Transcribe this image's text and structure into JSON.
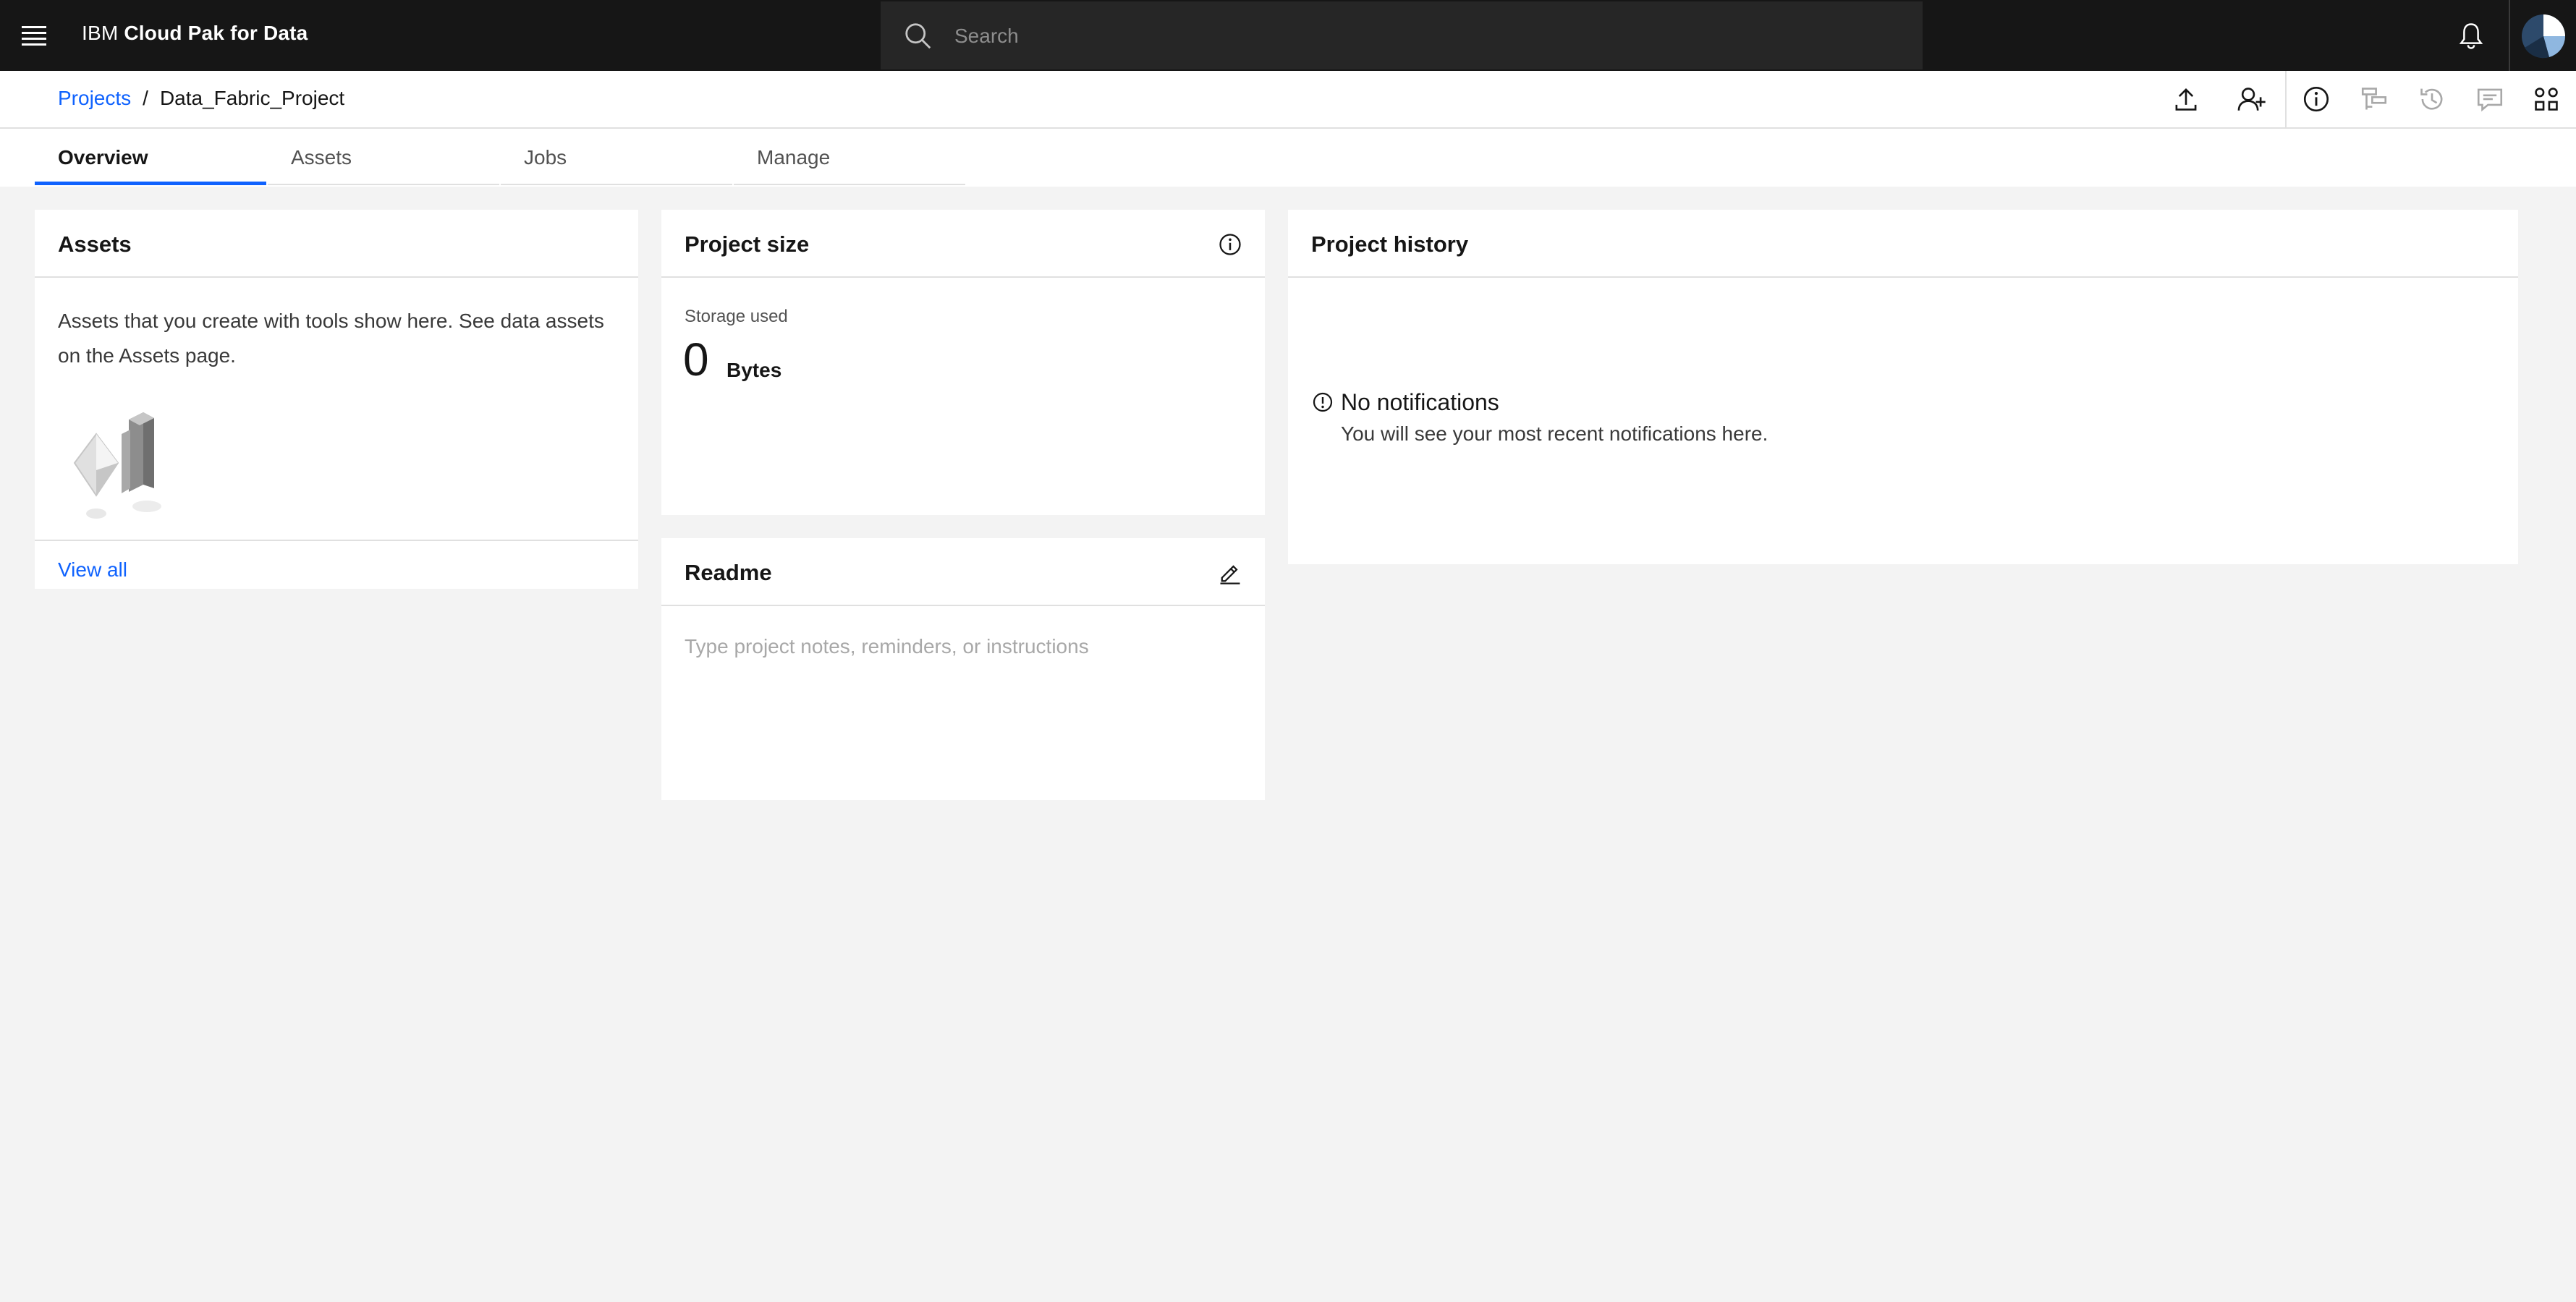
{
  "topbar": {
    "brand_prefix": "IBM",
    "brand_name": "Cloud Pak for Data",
    "search_placeholder": "Search"
  },
  "breadcrumb": {
    "parent": "Projects",
    "separator": "/",
    "current": "Data_Fabric_Project"
  },
  "tabs": [
    {
      "label": "Overview",
      "active": true
    },
    {
      "label": "Assets",
      "active": false
    },
    {
      "label": "Jobs",
      "active": false
    },
    {
      "label": "Manage",
      "active": false
    }
  ],
  "assets_card": {
    "title": "Assets",
    "description": "Assets that you create with tools show here. See data assets on the Assets page.",
    "view_all": "View all"
  },
  "project_size_card": {
    "title": "Project size",
    "storage_label": "Storage used",
    "storage_value": "0",
    "storage_unit": "Bytes"
  },
  "readme_card": {
    "title": "Readme",
    "placeholder": "Type project notes, reminders, or instructions"
  },
  "history_card": {
    "title": "Project history",
    "empty_title": "No notifications",
    "empty_message": "You will see your most recent notifications here."
  },
  "colors": {
    "accent": "#0f62fe",
    "header_bg": "#161616",
    "page_bg": "#f3f3f3"
  },
  "icons": [
    "menu-icon",
    "search-icon",
    "notification-icon",
    "avatar",
    "upload-icon",
    "add-user-icon",
    "info-icon",
    "lineage-icon",
    "history-icon",
    "comment-icon",
    "apps-icon",
    "edit-icon",
    "warning-icon"
  ]
}
